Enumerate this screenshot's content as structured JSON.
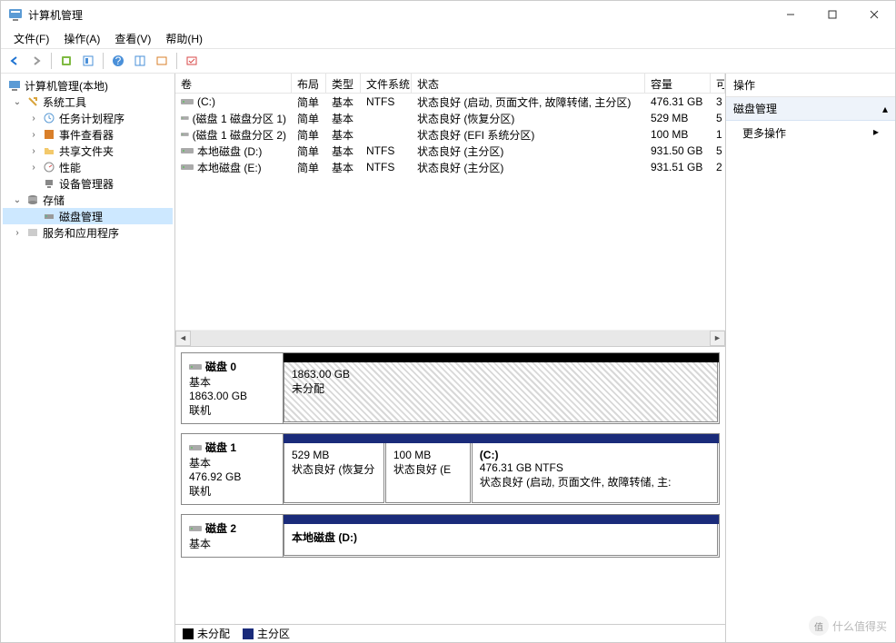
{
  "window": {
    "title": "计算机管理"
  },
  "menu": {
    "file": "文件(F)",
    "action": "操作(A)",
    "view": "查看(V)",
    "help": "帮助(H)"
  },
  "tree": {
    "root": "计算机管理(本地)",
    "system_tools": "系统工具",
    "task_scheduler": "任务计划程序",
    "event_viewer": "事件查看器",
    "shared_folders": "共享文件夹",
    "performance": "性能",
    "device_manager": "设备管理器",
    "storage": "存储",
    "disk_management": "磁盘管理",
    "services_apps": "服务和应用程序"
  },
  "vol_headers": {
    "volume": "卷",
    "layout": "布局",
    "type": "类型",
    "fs": "文件系统",
    "status": "状态",
    "capacity": "容量",
    "free": "可"
  },
  "volumes": [
    {
      "name": "(C:)",
      "layout": "简单",
      "type": "基本",
      "fs": "NTFS",
      "status": "状态良好 (启动, 页面文件, 故障转储, 主分区)",
      "capacity": "476.31 GB",
      "free": "3"
    },
    {
      "name": "(磁盘 1 磁盘分区 1)",
      "layout": "简单",
      "type": "基本",
      "fs": "",
      "status": "状态良好 (恢复分区)",
      "capacity": "529 MB",
      "free": "5"
    },
    {
      "name": "(磁盘 1 磁盘分区 2)",
      "layout": "简单",
      "type": "基本",
      "fs": "",
      "status": "状态良好 (EFI 系统分区)",
      "capacity": "100 MB",
      "free": "1"
    },
    {
      "name": "本地磁盘 (D:)",
      "layout": "简单",
      "type": "基本",
      "fs": "NTFS",
      "status": "状态良好 (主分区)",
      "capacity": "931.50 GB",
      "free": "5"
    },
    {
      "name": "本地磁盘 (E:)",
      "layout": "简单",
      "type": "基本",
      "fs": "NTFS",
      "status": "状态良好 (主分区)",
      "capacity": "931.51 GB",
      "free": "2"
    }
  ],
  "disks": {
    "d0": {
      "name": "磁盘 0",
      "type": "基本",
      "size": "1863.00 GB",
      "status": "联机",
      "parts": [
        {
          "label": "",
          "size": "1863.00 GB",
          "status": "未分配",
          "kind": "unalloc",
          "flex": 1
        }
      ]
    },
    "d1": {
      "name": "磁盘 1",
      "type": "基本",
      "size": "476.92 GB",
      "status": "联机",
      "parts": [
        {
          "label": "",
          "size": "529 MB",
          "status": "状态良好 (恢复分",
          "kind": "primary",
          "flex": 0.22
        },
        {
          "label": "",
          "size": "100 MB",
          "status": "状态良好 (E",
          "kind": "primary",
          "flex": 0.18
        },
        {
          "label": "(C:)",
          "size": "476.31 GB NTFS",
          "status": "状态良好 (启动, 页面文件, 故障转储, 主:",
          "kind": "primary",
          "flex": 0.6
        }
      ]
    },
    "d2": {
      "name": "磁盘 2",
      "type": "基本",
      "size": "",
      "status": "",
      "parts": [
        {
          "label": "本地磁盘  (D:)",
          "size": "",
          "status": "",
          "kind": "primary",
          "flex": 1
        }
      ]
    }
  },
  "legend": {
    "unalloc": "未分配",
    "primary": "主分区"
  },
  "actions": {
    "header": "操作",
    "section": "磁盘管理",
    "more": "更多操作"
  },
  "watermark": {
    "text": "什么值得买",
    "sub": "值"
  }
}
